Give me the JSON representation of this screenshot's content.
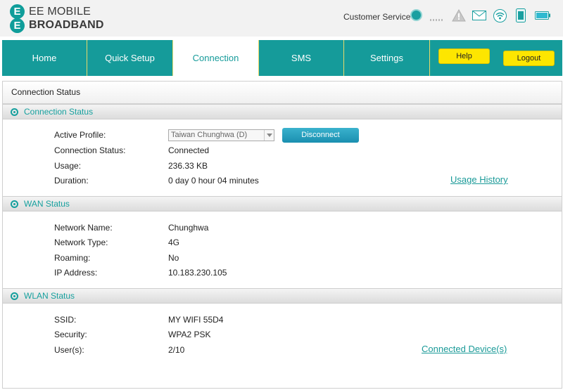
{
  "header": {
    "logo_line1": "EE MOBILE",
    "logo_line2": "BROADBAND",
    "logo_mark": "E",
    "customer_service": "Customer Service",
    "status_icons": [
      "globe-icon",
      "signal-icon",
      "warning-icon",
      "mail-icon",
      "wifi-icon",
      "phone-icon",
      "battery-icon"
    ]
  },
  "nav": {
    "tabs": [
      {
        "label": "Home"
      },
      {
        "label": "Quick Setup"
      },
      {
        "label": "Connection",
        "active": true
      },
      {
        "label": "SMS"
      },
      {
        "label": "Settings"
      }
    ],
    "help_label": "Help",
    "logout_label": "Logout"
  },
  "page_title": "Connection Status",
  "connection": {
    "title": "Connection Status",
    "active_profile_label": "Active Profile:",
    "active_profile_value": "Taiwan Chunghwa (D)",
    "disconnect_label": "Disconnect",
    "status_label": "Connection Status:",
    "status_value": "Connected",
    "usage_label": "Usage:",
    "usage_value": "236.33 KB",
    "duration_label": "Duration:",
    "duration_value": "0 day 0 hour 04 minutes",
    "usage_history_link": "Usage History"
  },
  "wan": {
    "title": "WAN Status",
    "network_name_label": "Network Name:",
    "network_name_value": "Chunghwa",
    "network_type_label": "Network Type:",
    "network_type_value": "4G",
    "roaming_label": "Roaming:",
    "roaming_value": "No",
    "ip_label": "IP Address:",
    "ip_value": "10.183.230.105"
  },
  "wlan": {
    "title": "WLAN Status",
    "ssid_label": "SSID:",
    "ssid_value": "MY WIFI 55D4",
    "security_label": "Security:",
    "security_value": "WPA2 PSK",
    "users_label": "User(s):",
    "users_value": "2/10",
    "connected_devices_link": "Connected Device(s)"
  },
  "colors": {
    "brand_teal": "#159b9a",
    "accent_yellow": "#fde600",
    "disconnect_blue": "#1a8fb0"
  }
}
